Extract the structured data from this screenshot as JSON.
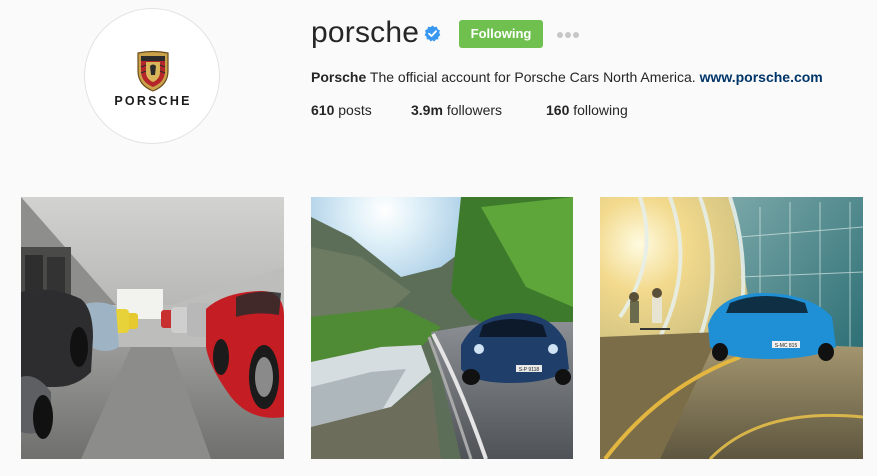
{
  "profile": {
    "username": "porsche",
    "logo_text": "PORSCHE",
    "follow_label": "Following",
    "bio_name": "Porsche",
    "bio_text": "The official account for Porsche Cars North America.",
    "bio_link": "www.porsche.com",
    "stats": {
      "posts_count": "610",
      "posts_label": "posts",
      "followers_count": "3.9m",
      "followers_label": "followers",
      "following_count": "160",
      "following_label": "following"
    }
  },
  "icons": {
    "verified": "verified-badge-icon",
    "options": "more-options-icon"
  },
  "colors": {
    "background": "#fafafa",
    "follow_button": "#70c050",
    "link": "#003569",
    "verified": "#3897f0"
  },
  "photos": {
    "plates": [
      "S-P 9118",
      "S-MC 815"
    ]
  }
}
